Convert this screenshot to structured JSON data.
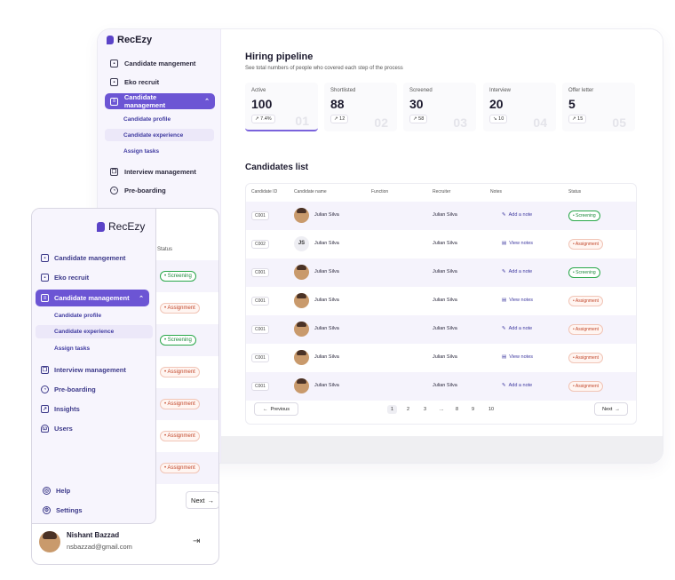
{
  "brand": {
    "name": "RecEzy",
    "accent": "#6c55d4"
  },
  "sidebar": {
    "items": [
      {
        "label": "Candidate mangement",
        "icon": "board-icon"
      },
      {
        "label": "Eko recruit",
        "icon": "board-icon"
      },
      {
        "label": "Candidate management",
        "icon": "layers-icon",
        "active": true
      },
      {
        "label": "Interview management",
        "icon": "copy-icon"
      },
      {
        "label": "Pre-boarding",
        "icon": "pie-icon"
      },
      {
        "label": "Insights",
        "icon": "chart-icon"
      },
      {
        "label": "Users",
        "icon": "users-icon"
      }
    ],
    "subitems": [
      "Candidate profile",
      "Candidate experience",
      "Assign tasks"
    ],
    "help": "Help",
    "settings": "Settings",
    "user": {
      "name": "Nishant Bazzad",
      "email": "nsbazzad@gmail.com"
    }
  },
  "pipeline": {
    "title": "Hiring pipeline",
    "subtitle": "See total numbers of people who covered each step of the process",
    "stages": [
      {
        "label": "Active",
        "value": "100",
        "change": "↗ 7.4%",
        "index": "01",
        "active": true
      },
      {
        "label": "Shortlisted",
        "value": "88",
        "change": "↗ 12",
        "index": "02"
      },
      {
        "label": "Screened",
        "value": "30",
        "change": "↗ 58",
        "index": "03"
      },
      {
        "label": "Interview",
        "value": "20",
        "change": "↘ 10",
        "index": "04"
      },
      {
        "label": "Offer letter",
        "value": "5",
        "change": "↗ 15",
        "index": "05"
      }
    ]
  },
  "candidates": {
    "title": "Candidates list",
    "columns": [
      "Candidate ID",
      "Candidate name",
      "Function",
      "Recruiter",
      "Notes",
      "Status"
    ],
    "rows": [
      {
        "id": "C001",
        "name": "Julian Silva",
        "initials": "",
        "recruiter": "Julian Silva",
        "note": "Add a note",
        "note_icon": "pencil-icon",
        "status": "Screening",
        "status_type": "green"
      },
      {
        "id": "C002",
        "name": "Julian Silva",
        "initials": "JS",
        "recruiter": "Julian Silva",
        "note": "View notes",
        "note_icon": "doc-icon",
        "status": "Assignment",
        "status_type": "orange"
      },
      {
        "id": "C001",
        "name": "Julian Silva",
        "initials": "",
        "recruiter": "Julian Silva",
        "note": "Add a note",
        "note_icon": "pencil-icon",
        "status": "Screening",
        "status_type": "green"
      },
      {
        "id": "C001",
        "name": "Julian Silva",
        "initials": "",
        "recruiter": "Julian Silva",
        "note": "View notes",
        "note_icon": "doc-icon",
        "status": "Assignment",
        "status_type": "orange"
      },
      {
        "id": "C001",
        "name": "Julian Silva",
        "initials": "",
        "recruiter": "Julian Silva",
        "note": "Add a note",
        "note_icon": "pencil-icon",
        "status": "Assignment",
        "status_type": "orange"
      },
      {
        "id": "C001",
        "name": "Julian Silva",
        "initials": "",
        "recruiter": "Julian Silva",
        "note": "View notes",
        "note_icon": "doc-icon",
        "status": "Assignment",
        "status_type": "orange"
      },
      {
        "id": "C001",
        "name": "Julian Silva",
        "initials": "",
        "recruiter": "Julian Silva",
        "note": "Add a note",
        "note_icon": "pencil-icon",
        "status": "Assignment",
        "status_type": "orange"
      }
    ],
    "pagination": {
      "previous": "Previous",
      "next": "Next",
      "pages": [
        "1",
        "2",
        "3",
        "...",
        "8",
        "9",
        "10"
      ],
      "current": "1"
    }
  },
  "front_panel": {
    "status_header": "Status",
    "statuses": [
      {
        "label": "Screening",
        "type": "green"
      },
      {
        "label": "Assignment",
        "type": "orange"
      },
      {
        "label": "Screening",
        "type": "green"
      },
      {
        "label": "Assignment",
        "type": "orange"
      },
      {
        "label": "Assignment",
        "type": "orange"
      },
      {
        "label": "Assignment",
        "type": "orange"
      },
      {
        "label": "Assignment",
        "type": "orange"
      }
    ],
    "next": "Next"
  }
}
